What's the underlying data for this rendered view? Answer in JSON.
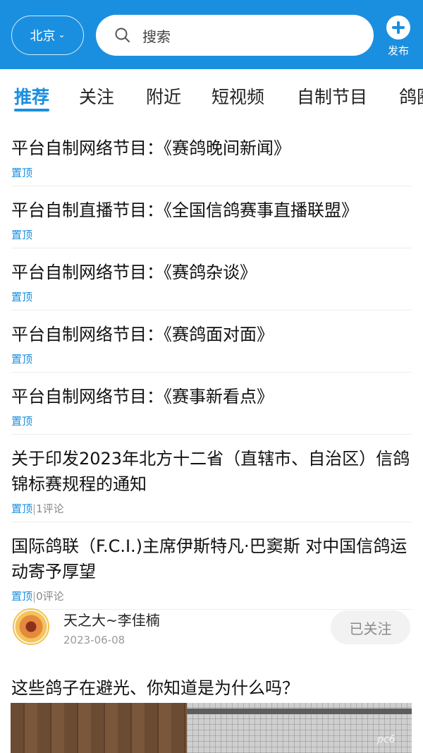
{
  "header": {
    "city": "北京",
    "search_placeholder": "搜索",
    "publish_label": "发布",
    "accent_color": "#1a8fe0"
  },
  "tabs": [
    {
      "label": "推荐",
      "active": true
    },
    {
      "label": "关注"
    },
    {
      "label": "附近"
    },
    {
      "label": "短视频"
    },
    {
      "label": "自制节目"
    },
    {
      "label": "鸽圈"
    }
  ],
  "feed": [
    {
      "title": "平台自制网络节目：《赛鸽晚间新闻》",
      "pin": "置顶",
      "comments": ""
    },
    {
      "title": "平台自制直播节目：《全国信鸽赛事直播联盟》",
      "pin": "置顶",
      "comments": ""
    },
    {
      "title": "平台自制网络节目：《赛鸽杂谈》",
      "pin": "置顶",
      "comments": ""
    },
    {
      "title": "平台自制网络节目：《赛鸽面对面》",
      "pin": "置顶",
      "comments": ""
    },
    {
      "title": "平台自制网络节目：《赛事新看点》",
      "pin": "置顶",
      "comments": ""
    },
    {
      "title": "关于印发2023年北方十二省（直辖市、自治区）信鸽锦标赛规程的通知",
      "pin": "置顶",
      "comments": "1评论"
    },
    {
      "title": "国际鸽联（F.C.I.)主席伊斯特凡·巴窦斯 对中国信鸽运动寄予厚望",
      "pin": "置顶",
      "comments": "0评论"
    }
  ],
  "author_post": {
    "name": "天之大~李佳楠",
    "date": "2023-06-08",
    "follow_label": "已关注",
    "title": "这些鸽子在避光、你知道是为什么吗？"
  },
  "watermark": "pc6"
}
